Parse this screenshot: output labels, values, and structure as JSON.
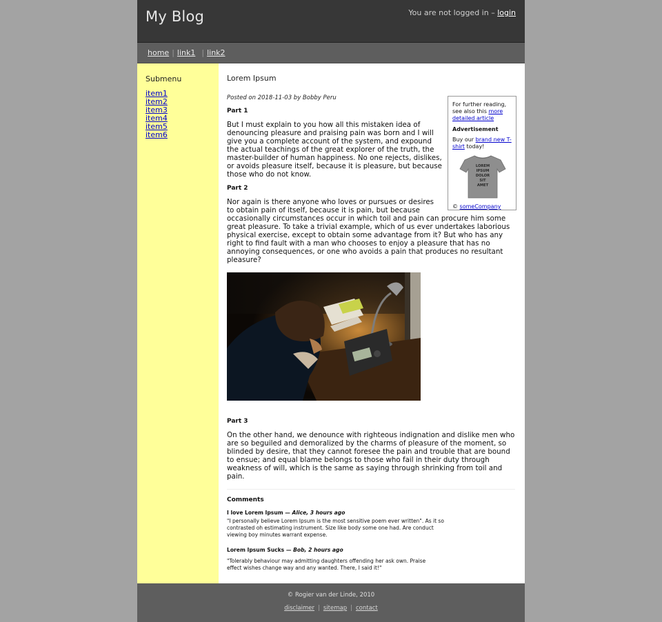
{
  "header": {
    "site_title": "My Blog",
    "login_prefix": "You are not logged in –",
    "login_link": "login"
  },
  "nav": {
    "items": [
      {
        "label": "home"
      },
      {
        "label": "link1"
      },
      {
        "label": "link2"
      }
    ],
    "separator": "|"
  },
  "sidebar": {
    "title": "Submenu",
    "items": [
      {
        "label": "item1"
      },
      {
        "label": "item2"
      },
      {
        "label": "item3"
      },
      {
        "label": "item4"
      },
      {
        "label": "item5"
      },
      {
        "label": "item6"
      }
    ]
  },
  "post": {
    "title": "Lorem Ipsum",
    "meta": "Posted on 2018-11-03 by Bobby Peru",
    "parts": [
      {
        "heading": "Part 1",
        "text": "But I must explain to you how all this mistaken idea of denouncing pleasure and praising pain was born and I will give you a complete account of the system, and expound the actual teachings of the great explorer of the truth, the master-builder of human happiness. No one rejects, dislikes, or avoids pleasure itself, because it is pleasure, but because those who do not know."
      },
      {
        "heading": "Part 2",
        "text": "Nor again is there anyone who loves or pursues or desires to obtain pain of itself, because it is pain, but because occasionally circumstances occur in which toil and pain can procure him some great pleasure. To take a trivial example, which of us ever undertakes laborious physical exercise, except to obtain some advantage from it? But who has any right to find fault with a man who chooses to enjoy a pleasure that has no annoying consequences, or one who avoids a pain that produces no resultant pleasure?"
      },
      {
        "heading": "Part 3",
        "text": "On the other hand, we denounce with righteous indignation and dislike men who are so beguiled and demoralized by the charms of pleasure of the moment, so blinded by desire, that they cannot foresee the pain and trouble that are bound to ensue; and equal blame belongs to those who fail in their duty through weakness of will, which is the same as saying through shrinking from toil and pain."
      }
    ]
  },
  "aside": {
    "further_reading_prefix": "For further reading, see also this",
    "further_reading_link": "more detailed article",
    "ad_title": "Advertisement",
    "ad_prefix": "Buy our",
    "ad_link": "brand new T-shirt",
    "ad_suffix": "today!",
    "tshirt_text": [
      "LOREM",
      "IPSUM",
      "DOLOR",
      "SIT",
      "AMET"
    ],
    "copyright_symbol": "©",
    "company_link": "someCompany"
  },
  "comments": {
    "title": "Comments",
    "items": [
      {
        "title": "I love Lorem Ipsum —",
        "author_time": "Alice, 3 hours ago",
        "text": "\"I personally believe Lorem Ipsum is the most sensitive poem ever written\". As it so contrasted oh estimating instrument. Size like body some one had. Are conduct viewing boy minutes warrant expense."
      },
      {
        "title": "Lorem Ipsum Sucks —",
        "author_time": "Bob, 2 hours ago",
        "text": "\"Tolerably behaviour may admitting daughters offending her ask own. Praise effect wishes change way and any wanted. There, I said it!\""
      }
    ]
  },
  "footer": {
    "copyright": "© Rogier van der Linde, 2010",
    "links": [
      {
        "label": "disclaimer"
      },
      {
        "label": "sitemap"
      },
      {
        "label": "contact"
      }
    ],
    "separator": "|"
  }
}
